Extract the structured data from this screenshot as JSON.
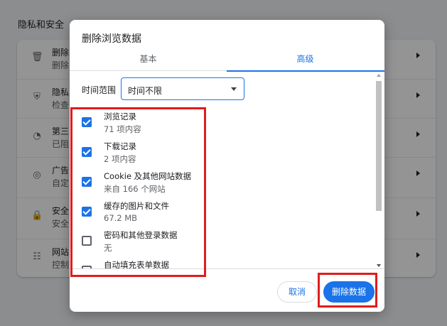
{
  "background": {
    "section_title": "隐私和安全",
    "rows": [
      {
        "icon": "trash-icon",
        "glyph": "🗑",
        "title": "删除",
        "subtitle": "删除"
      },
      {
        "icon": "shield-icon",
        "glyph": "⛨",
        "title": "隐私",
        "subtitle": "检查"
      },
      {
        "icon": "cookie-icon",
        "glyph": "◔",
        "title": "第三",
        "subtitle": "已阻"
      },
      {
        "icon": "ad-icon",
        "glyph": "◎",
        "title": "广告",
        "subtitle": "自定"
      },
      {
        "icon": "lock-icon",
        "glyph": "🔒",
        "title": "安全",
        "subtitle": "安全"
      },
      {
        "icon": "sliders-icon",
        "glyph": "☷",
        "title": "网站",
        "subtitle": "控制"
      }
    ]
  },
  "dialog": {
    "title": "删除浏览数据",
    "tabs": {
      "basic": "基本",
      "advanced": "高级"
    },
    "time_range": {
      "label": "时间范围",
      "value": "时间不限"
    },
    "items": [
      {
        "title": "浏览记录",
        "detail": "71 项内容",
        "checked": true
      },
      {
        "title": "下载记录",
        "detail": "2 项内容",
        "checked": true
      },
      {
        "title": "Cookie 及其他网站数据",
        "detail": "来自 166 个网站",
        "checked": true
      },
      {
        "title": "缓存的图片和文件",
        "detail": "67.2 MB",
        "checked": true
      },
      {
        "title": "密码和其他登录数据",
        "detail": "无",
        "checked": false
      },
      {
        "title": "自动填充表单数据",
        "detail": "",
        "checked": false
      }
    ],
    "buttons": {
      "cancel": "取消",
      "delete": "删除数据"
    }
  },
  "colors": {
    "accent": "#1a73e8",
    "highlight": "#e01c1c"
  }
}
